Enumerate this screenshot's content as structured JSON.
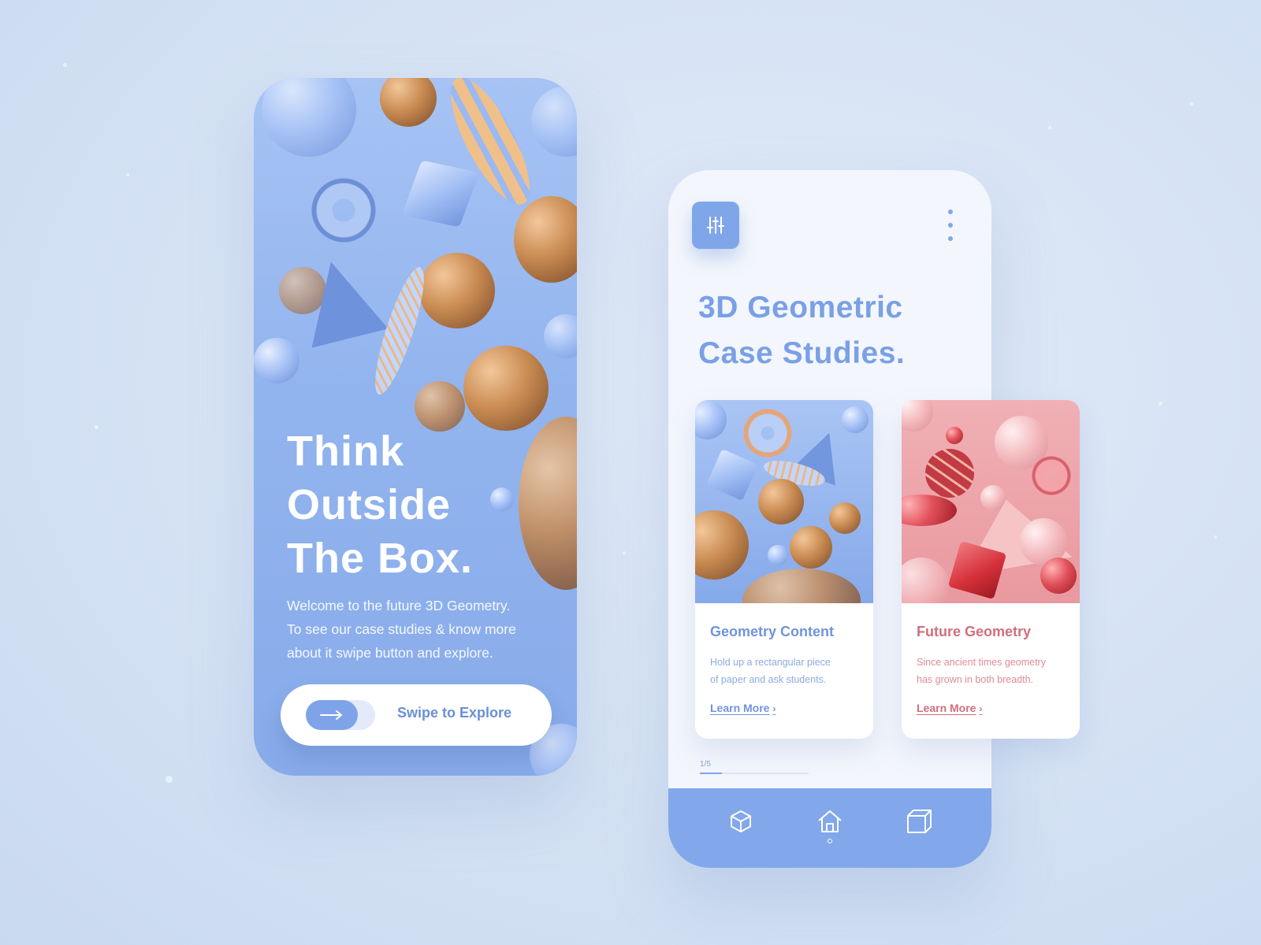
{
  "colors": {
    "background": "#d8e4f5",
    "brand_blue": "#80a6ea",
    "accent_red": "#d06f7b",
    "white": "#ffffff"
  },
  "onboarding": {
    "hero_title_lines": [
      "Think",
      "Outside",
      "The Box."
    ],
    "description_lines": [
      "Welcome to the future 3D Geometry.",
      "To see our case studies & know more",
      "about it swipe button and explore."
    ],
    "swipe_button": {
      "label": "Swipe to Explore",
      "icon": "arrow-right-icon"
    }
  },
  "case_studies": {
    "header": {
      "filter_icon": "sliders-icon",
      "menu_icon": "more-vertical-icon"
    },
    "title_lines": [
      "3D Geometric",
      "Case Studies."
    ],
    "cards": [
      {
        "title": "Geometry Content",
        "description_lines": [
          "Hold up a rectangular piece",
          "of paper and ask students."
        ],
        "link_label": "Learn More",
        "theme": "#80a6ea"
      },
      {
        "title": "Future Geometry",
        "description_lines": [
          "Since ancient times geometry",
          "has grown in both breadth."
        ],
        "link_label": "Learn More",
        "theme": "#d06f7b"
      }
    ],
    "pager": {
      "label": "1/5",
      "current": 1,
      "total": 5
    },
    "bottom_nav": {
      "items": [
        {
          "icon": "cube-icon",
          "active": false
        },
        {
          "icon": "home-icon",
          "active": true
        },
        {
          "icon": "box-icon",
          "active": false
        }
      ]
    }
  }
}
